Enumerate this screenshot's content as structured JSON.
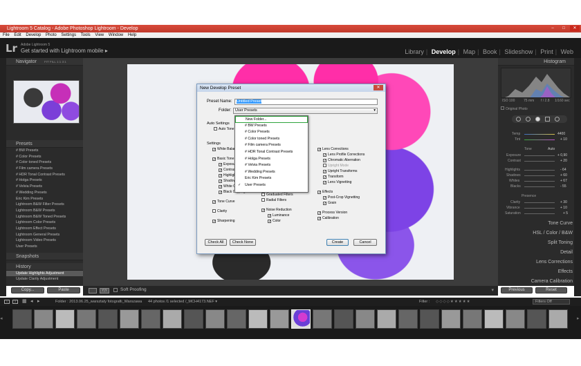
{
  "window": {
    "title": "Lightroom 5 Catalog - Adobe Photoshop Lightroom - Develop"
  },
  "menu": [
    "File",
    "Edit",
    "Develop",
    "Photo",
    "Settings",
    "Tools",
    "View",
    "Window",
    "Help"
  ],
  "identity": {
    "small": "Adobe Lightroom 5",
    "main": "Get started with Lightroom mobile ▸",
    "logo": "Lr"
  },
  "modules": [
    "Library",
    "Develop",
    "Map",
    "Book",
    "Slideshow",
    "Print",
    "Web"
  ],
  "active_module": "Develop",
  "navigator": {
    "title": "Navigator",
    "zoom": "FIT FILL 1:1 3:1"
  },
  "presets": {
    "title": "Presets",
    "items": [
      "# BW Presets",
      "# Color Presets",
      "# Color toned Presets",
      "# Film camera Presets",
      "# HDR Tonal Contrast Presets",
      "# Holga Presets",
      "# Velvia Presets",
      "# Wedding Presets",
      "Eric Kim Presets",
      "Lightroom B&W Filter Presets",
      "Lightroom B&W Presets",
      "Lightroom B&W Toned Presets",
      "Lightroom Color Presets",
      "Lightroom Effect Presets",
      "Lightroom General Presets",
      "Lightroom Video Presets",
      "User Presets"
    ]
  },
  "snapshots": {
    "title": "Snapshots"
  },
  "history": {
    "title": "History",
    "items": [
      "Update Highlights Adjustment",
      "Update Clarity Adjustment"
    ]
  },
  "left_buttons": {
    "copy": "Copy...",
    "paste": "Paste"
  },
  "toolbar": {
    "soft_proofing": "Soft Proofing"
  },
  "dialog": {
    "title": "New Develop Preset",
    "preset_name_label": "Preset Name:",
    "preset_name_value": "Untitled Preset",
    "folder_label": "Folder:",
    "folder_value": "User Presets",
    "auto_settings": "Auto Settings",
    "auto_tone": "Auto Tone",
    "settings": "Settings",
    "white_balance": "White Balance",
    "basic_tone": "Basic Tone",
    "basic_children": [
      "Exposure",
      "Contrast",
      "Highlights",
      "Shadows",
      "White Clipping",
      "Black Clipping"
    ],
    "tone_curve": "Tone Curve",
    "clarity": "Clarity",
    "sharpening": "Sharpening",
    "graduated_filters": "Graduated Filters",
    "radial_filters": "Radial Filters",
    "noise_reduction": "Noise Reduction",
    "luminance": "Luminance",
    "color": "Color",
    "lens_corrections": "Lens Corrections",
    "lens_children": [
      "Lens Profile Corrections",
      "Chromatic Aberration",
      "Upright Mode",
      "Upright Transforms",
      "Transform",
      "Lens Vignetting"
    ],
    "effects": "Effects",
    "effects_children": [
      "Post-Crop Vignetting",
      "Grain"
    ],
    "process_version": "Process Version",
    "calibration": "Calibration",
    "check_all": "Check All",
    "check_none": "Check None",
    "create": "Create",
    "cancel": "Cancel"
  },
  "folder_dropdown": {
    "items": [
      "New Folder...",
      "# BW Presets",
      "# Color Presets",
      "# Color toned Presets",
      "# Film camera Presets",
      "# HDR Tonal Contrast Presets",
      "# Holga Presets",
      "# Velvia Presets",
      "# Wedding Presets",
      "Eric Kim Presets",
      "User Presets"
    ],
    "checked": "User Presets",
    "highlighted": "New Folder..."
  },
  "right_panel": {
    "histogram": "Histogram",
    "hist_info": [
      "ISO 100",
      "75 mm",
      "f / 2.8",
      "1/160 sec"
    ],
    "original_photo": "Original Photo",
    "basic_labels": [
      "Temp",
      "Tint",
      "Tone",
      "Auto",
      "Exposure",
      "Contrast",
      "Highlights",
      "Shadows",
      "Whites",
      "Blacks",
      "Presence",
      "Clarity",
      "Vibrance",
      "Saturation"
    ],
    "basic_values": [
      "4400",
      "+ 10",
      "+ 0,90",
      "+ 20",
      "- 64",
      "+ 60",
      "+ 67",
      "- 55",
      "+ 30",
      "+ 10",
      "+ 5"
    ],
    "sections": [
      "Tone Curve",
      "HSL / Color / B&W",
      "Split Toning",
      "Detail",
      "Lens Corrections",
      "Effects",
      "Camera Calibration"
    ],
    "previous": "Previous",
    "reset": "Reset"
  },
  "filmstrip": {
    "path": "Folder : 2013.06.25_warsztaty fotografii_Warszawa",
    "count": "44 photos /1 selected /_MCH4173.NEF ▾",
    "filter_label": "Filter :",
    "filter_value": "Filters Off"
  },
  "colors": {
    "accent": "#2ea43c",
    "titlebar": "#c13a2c",
    "panel": "#2b2b2b"
  }
}
